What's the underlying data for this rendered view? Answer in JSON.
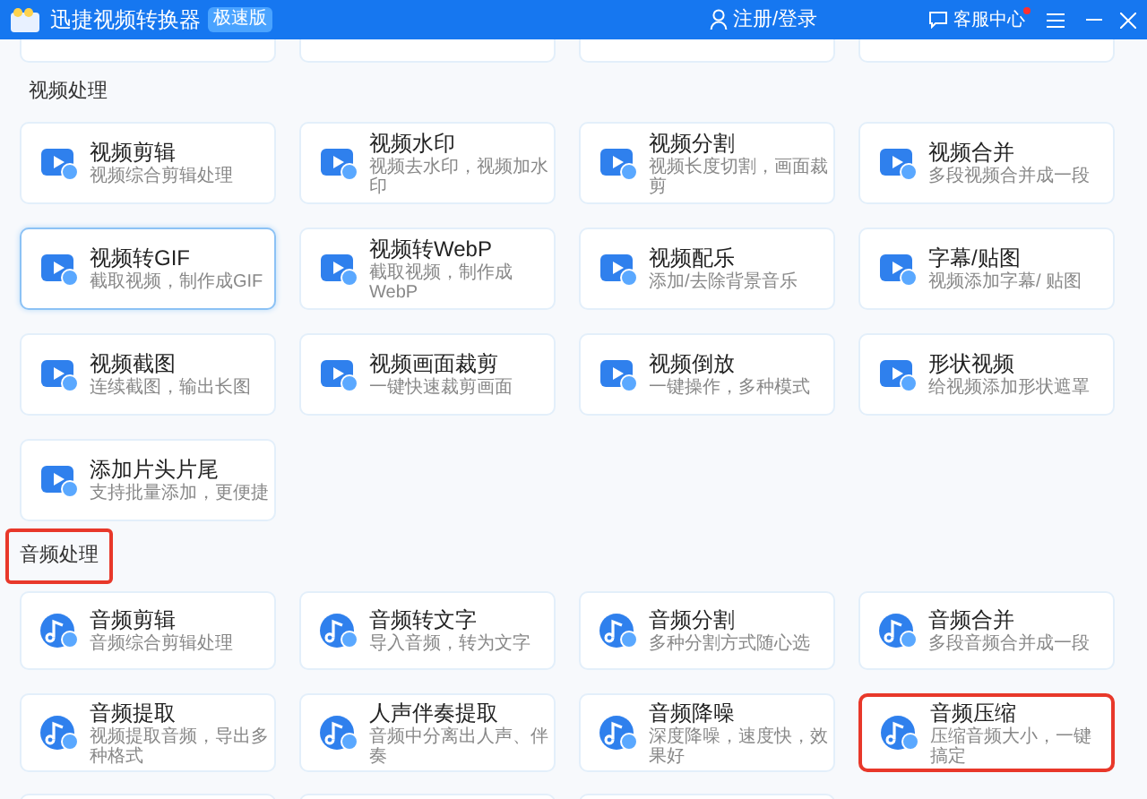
{
  "header": {
    "app_name": "迅捷视频转换器",
    "badge": "极速版",
    "login": "注册/登录",
    "support": "客服中心",
    "support_unread": true
  },
  "sections": [
    {
      "title": "视频处理",
      "highlighted": false,
      "kind": "video",
      "cards": [
        {
          "title": "视频剪辑",
          "subtitle": "视频综合剪辑处理",
          "selected": false,
          "highlighted": false
        },
        {
          "title": "视频水印",
          "subtitle": "视频去水印，视频加水印",
          "selected": false,
          "highlighted": false
        },
        {
          "title": "视频分割",
          "subtitle": "视频长度切割，画面裁剪",
          "selected": false,
          "highlighted": false
        },
        {
          "title": "视频合并",
          "subtitle": "多段视频合并成一段",
          "selected": false,
          "highlighted": false
        },
        {
          "title": "视频转GIF",
          "subtitle": "截取视频，制作成GIF",
          "selected": true,
          "highlighted": false
        },
        {
          "title": "视频转WebP",
          "subtitle": "截取视频，制作成WebP",
          "selected": false,
          "highlighted": false
        },
        {
          "title": "视频配乐",
          "subtitle": "添加/去除背景音乐",
          "selected": false,
          "highlighted": false
        },
        {
          "title": "字幕/贴图",
          "subtitle": "视频添加字幕/ 贴图",
          "selected": false,
          "highlighted": false
        },
        {
          "title": "视频截图",
          "subtitle": "连续截图，输出长图",
          "selected": false,
          "highlighted": false
        },
        {
          "title": "视频画面裁剪",
          "subtitle": "一键快速裁剪画面",
          "selected": false,
          "highlighted": false
        },
        {
          "title": "视频倒放",
          "subtitle": "一键操作，多种模式",
          "selected": false,
          "highlighted": false
        },
        {
          "title": "形状视频",
          "subtitle": "给视频添加形状遮罩",
          "selected": false,
          "highlighted": false
        },
        {
          "title": "添加片头片尾",
          "subtitle": "支持批量添加，更便捷",
          "selected": false,
          "highlighted": false
        }
      ]
    },
    {
      "title": "音频处理",
      "highlighted": true,
      "kind": "audio",
      "cards": [
        {
          "title": "音频剪辑",
          "subtitle": "音频综合剪辑处理",
          "selected": false,
          "highlighted": false
        },
        {
          "title": "音频转文字",
          "subtitle": "导入音频，转为文字",
          "selected": false,
          "highlighted": false
        },
        {
          "title": "音频分割",
          "subtitle": "多种分割方式随心选",
          "selected": false,
          "highlighted": false
        },
        {
          "title": "音频合并",
          "subtitle": "多段音频合并成一段",
          "selected": false,
          "highlighted": false
        },
        {
          "title": "音频提取",
          "subtitle": "视频提取音频，导出多种格式",
          "selected": false,
          "highlighted": false
        },
        {
          "title": "人声伴奏提取",
          "subtitle": "音频中分离出人声、伴奏",
          "selected": false,
          "highlighted": false
        },
        {
          "title": "音频降噪",
          "subtitle": "深度降噪，速度快，效果好",
          "selected": false,
          "highlighted": false
        },
        {
          "title": "音频压缩",
          "subtitle": "压缩音频大小，一键搞定",
          "selected": false,
          "highlighted": true
        }
      ]
    }
  ]
}
